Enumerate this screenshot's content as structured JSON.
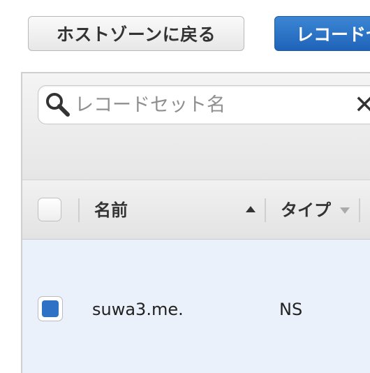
{
  "toolbar": {
    "back_label": "ホストゾーンに戻る",
    "record_label": "レコードセットの作成"
  },
  "search": {
    "placeholder": "レコードセット名",
    "value": "",
    "clear_glyph": "✕"
  },
  "table": {
    "columns": [
      {
        "label": "名前",
        "sort": "ascending"
      },
      {
        "label": "タイプ",
        "sort": "none"
      }
    ],
    "rows": [
      {
        "name": "suwa3.me.",
        "type": "NS",
        "selected": true
      }
    ]
  },
  "colors": {
    "primary_button": "#2466bc",
    "selected_row": "#eaf1fb",
    "checkbox_checked": "#2f72c5"
  }
}
